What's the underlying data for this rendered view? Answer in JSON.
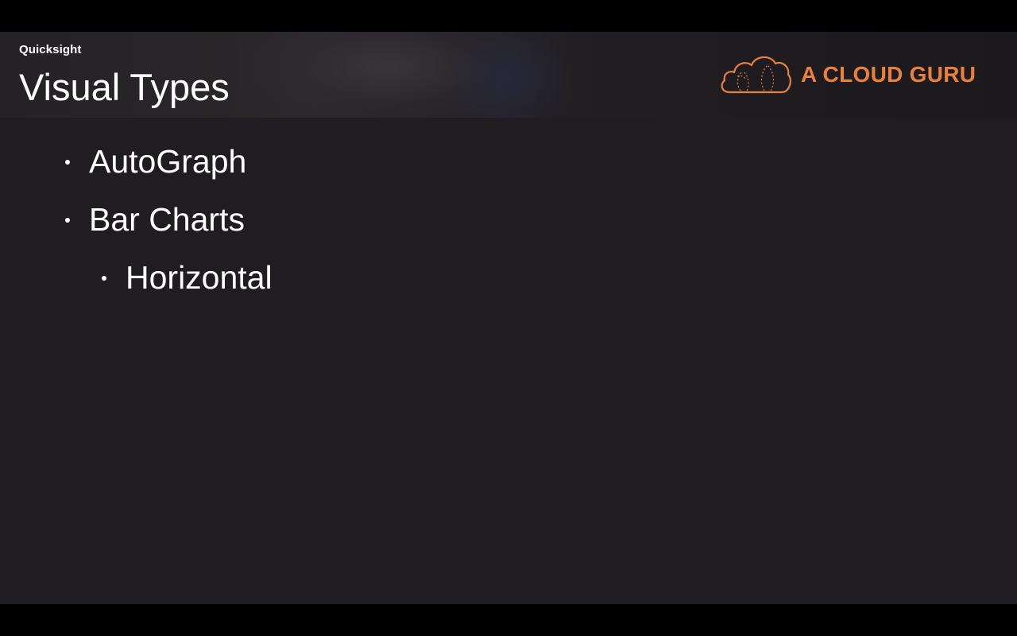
{
  "header": {
    "course_label": "Quicksight",
    "title": "Visual Types",
    "logo_text": "A CLOUD GURU",
    "logo_icon": "cloud-logo-icon"
  },
  "bullets": [
    {
      "text": "AutoGraph",
      "level": 1
    },
    {
      "text": "Bar Charts",
      "level": 1
    },
    {
      "text": "Horizontal",
      "level": 2
    }
  ],
  "colors": {
    "slide_background": "#1f1d21",
    "letterbox": "#000000",
    "text": "#ffffff",
    "brand_orange": "#e9803b"
  }
}
